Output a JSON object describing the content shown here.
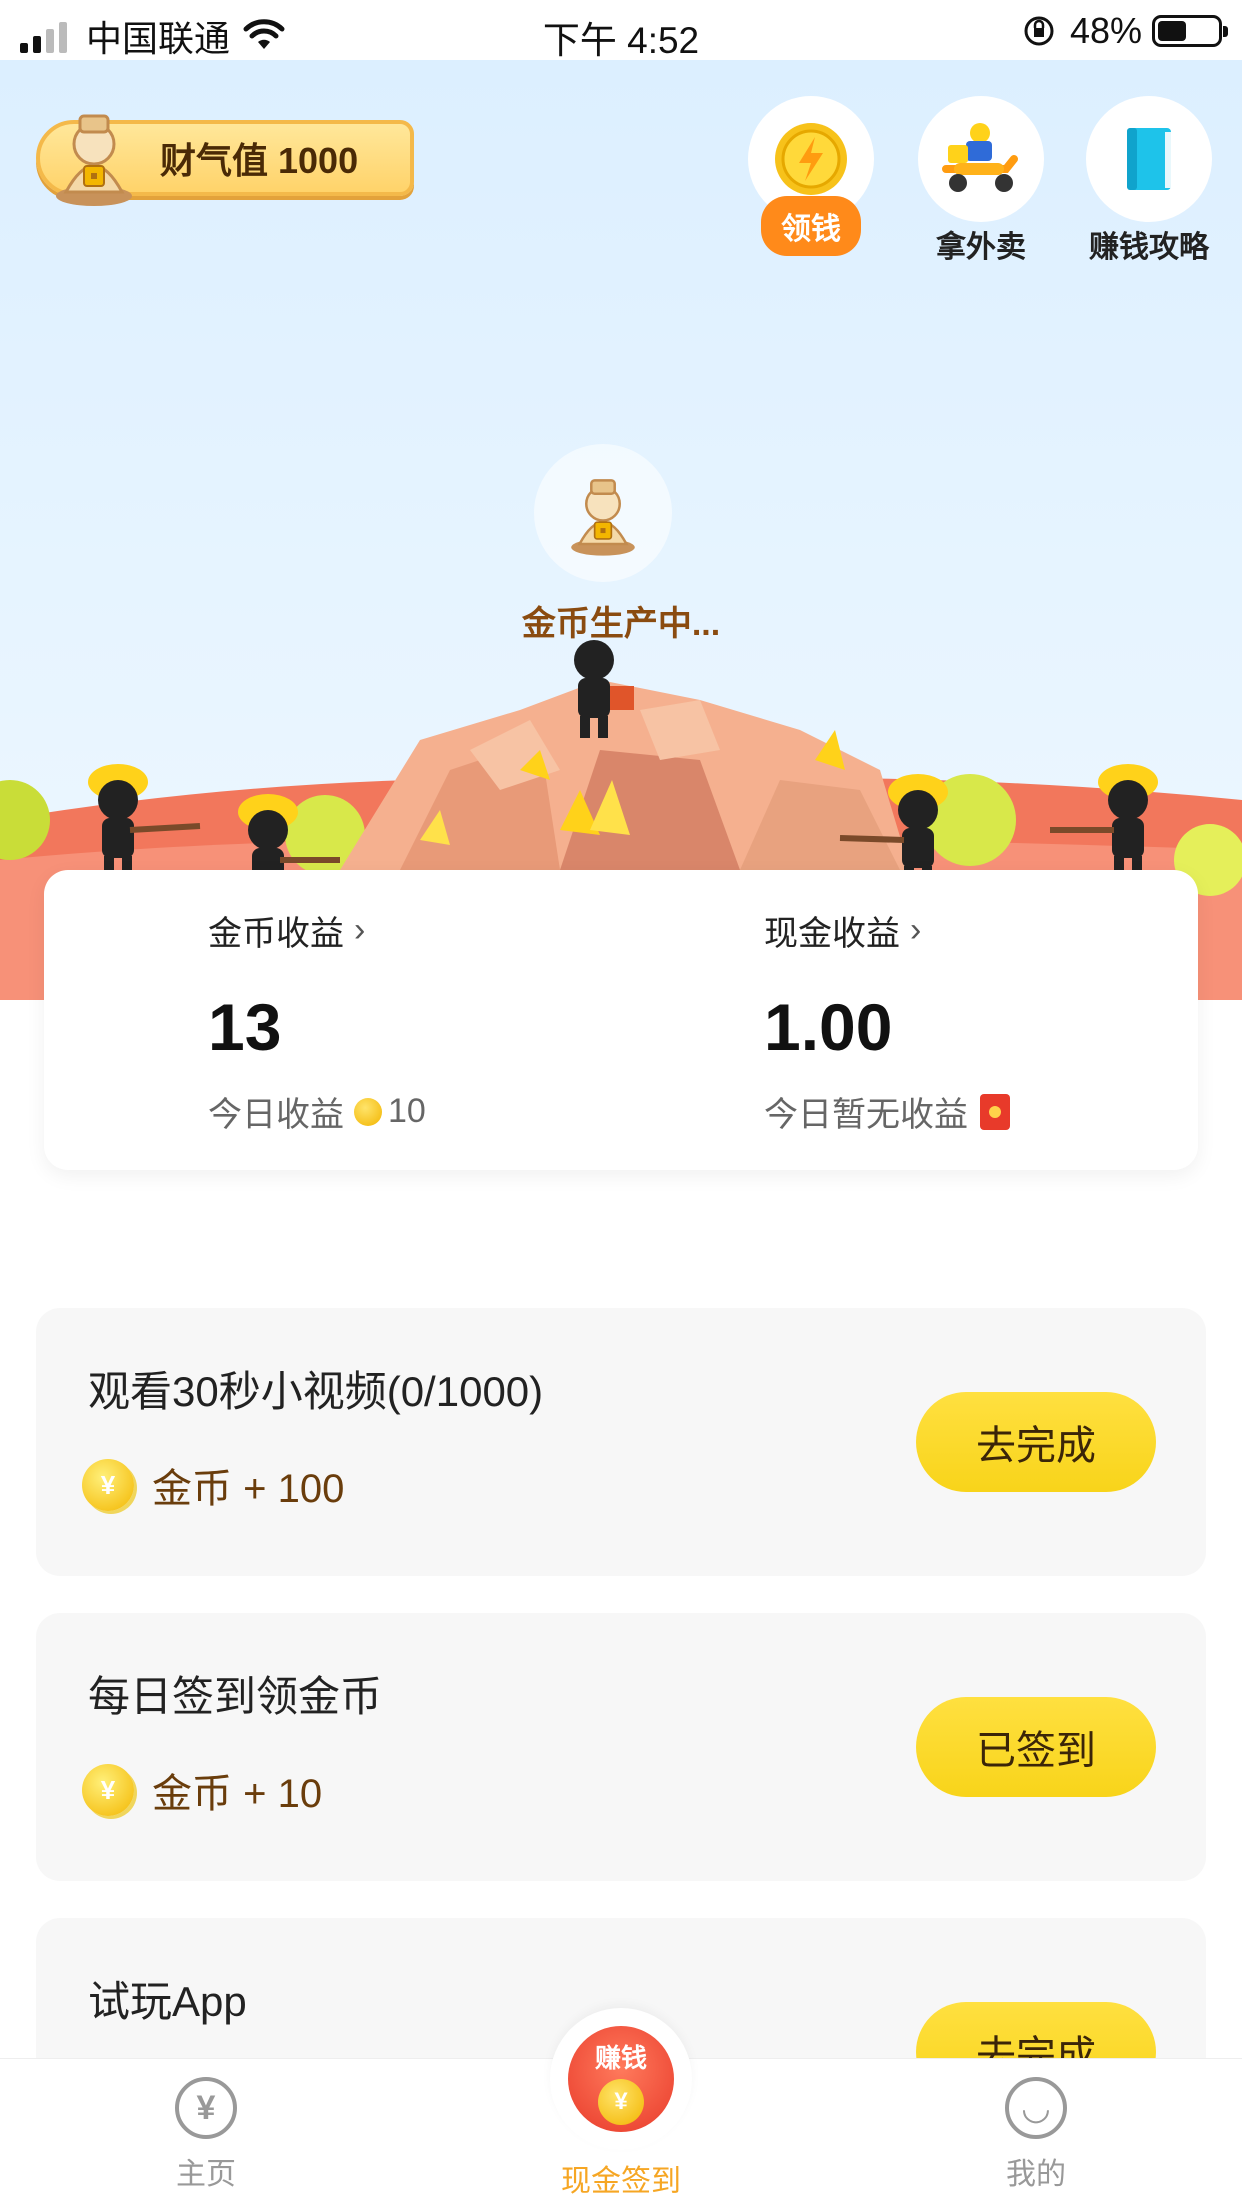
{
  "status_bar": {
    "carrier": "中国联通",
    "time": "下午 4:52",
    "battery": "48%",
    "battery_level": 0.48,
    "signal_bars": 2,
    "signal_total": 4
  },
  "hero": {
    "fortune_label": "财气值 1000",
    "top_icons": [
      {
        "label": "领钱",
        "icon": "lightning-coin-icon"
      },
      {
        "label": "拿外卖",
        "icon": "delivery-scooter-icon"
      },
      {
        "label": "赚钱攻略",
        "icon": "book-icon"
      }
    ],
    "producing_text": "金币生产中..."
  },
  "earnings": {
    "coin": {
      "header": "金币收益",
      "value": "13",
      "today_label": "今日收益",
      "today_value": "10"
    },
    "cash": {
      "header": "现金收益",
      "value": "1.00",
      "today_label": "今日暂无收益"
    }
  },
  "tasks": [
    {
      "title": "观看30秒小视频(0/1000)",
      "reward": "金币 + 100",
      "button": "去完成"
    },
    {
      "title": "每日签到领金币",
      "reward": "金币 + 10",
      "button": "已签到"
    },
    {
      "title": "试玩App",
      "reward": "",
      "button": "去完成"
    }
  ],
  "tab_bar": {
    "home": "主页",
    "center_badge": "赚钱",
    "center_coin": "¥",
    "center_label": "现金签到",
    "mine": "我的",
    "home_glyph": "¥",
    "mine_glyph": "◡"
  },
  "colors": {
    "accent_yellow": "#f8d41a",
    "accent_orange": "#ff8a1a",
    "active_tab": "#f6a623",
    "sky": "#dcefff"
  }
}
